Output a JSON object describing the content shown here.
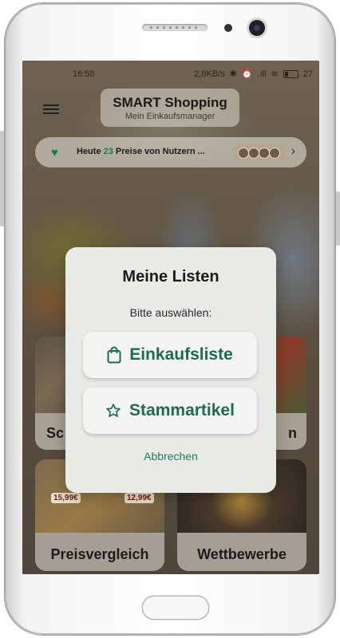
{
  "status_bar": {
    "time": "16:58",
    "net_speed": "2,8KB/s",
    "battery": "27"
  },
  "header": {
    "title": "SMART Shopping",
    "subtitle": "Mein Einkaufsmanager",
    "menu_icon": "menu-icon"
  },
  "banner": {
    "text_prefix": "Heute ",
    "count": "23",
    "text_suffix": " Preise von Nutzern ...",
    "icon": "heart-icon"
  },
  "tiles": [
    {
      "label": "Sc"
    },
    {
      "label": "n"
    },
    {
      "label": "Preisvergleich",
      "price_left": "15,99€",
      "price_right": "12,99€"
    },
    {
      "label": "Wettbewerbe"
    }
  ],
  "dialog": {
    "title": "Meine Listen",
    "subtitle": "Bitte auswählen:",
    "options": [
      {
        "label": "Einkaufsliste",
        "icon": "shopping-bag-icon"
      },
      {
        "label": "Stammartikel",
        "icon": "star-icon"
      }
    ],
    "cancel_label": "Abbrechen"
  },
  "colors": {
    "accent": "#1d6b52",
    "dialog_bg": "#e8eae6"
  }
}
